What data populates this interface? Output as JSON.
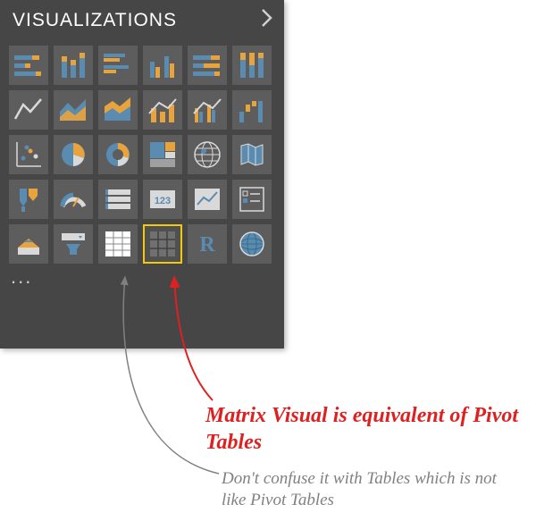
{
  "panel": {
    "title": "VISUALIZATIONS"
  },
  "icons": {
    "more": "..."
  },
  "selected_visual": "matrix",
  "r_label": "R",
  "kpi_digits": "123",
  "annotations": {
    "main": "Matrix Visual is equivalent of Pivot Tables",
    "sub": "Don't confuse it with Tables which is not like Pivot Tables"
  },
  "colors": {
    "panel_bg": "#464646",
    "selection": "#f2c811",
    "accent_red": "#e02020",
    "accent_gray": "#808080",
    "c_orange": "#e8a33d",
    "c_blue": "#5a8bb0",
    "c_light": "#d9d9d9"
  }
}
